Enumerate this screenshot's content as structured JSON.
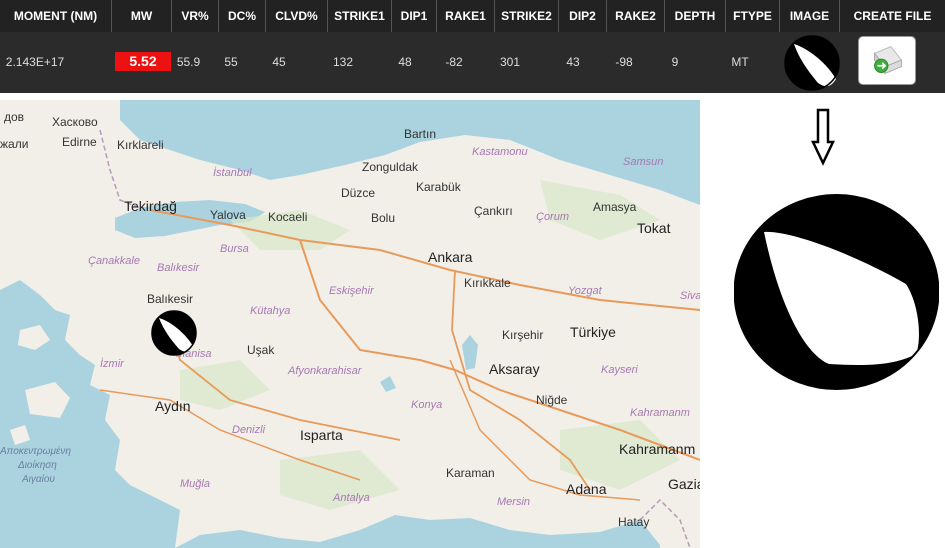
{
  "table": {
    "headers": [
      "MOMENT (NM)",
      "MW",
      "VR%",
      "DC%",
      "CLVD%",
      "STRIKE1",
      "DIP1",
      "RAKE1",
      "STRIKE2",
      "DIP2",
      "RAKE2",
      "DEPTH",
      "FTYPE",
      "IMAGE",
      "CREATE FILE"
    ],
    "row": {
      "moment": "2.143E+17",
      "mw": "5.52",
      "vr": "55.9",
      "dc": "55",
      "clvd": "45",
      "strike1": "132",
      "dip1": "48",
      "rake1": "-82",
      "strike2": "301",
      "dip2": "43",
      "rake2": "-98",
      "depth": "9",
      "ftype": "MT"
    }
  },
  "colors": {
    "mw_badge": "#ee1111",
    "header_bg": "#222222",
    "row_bg": "#2b2b2b",
    "sea": "#aad3df",
    "land": "#f2efe9"
  },
  "icons": {
    "image_cell": "beachball-icon",
    "create_file": "create-file-icon",
    "arrow": "down-arrow-icon"
  },
  "map": {
    "labels": {
      "edirne": "Edirne",
      "kirklareli": "Kırklareli",
      "hackovo": "Хасково",
      "dov": "дов",
      "zhali": "жали",
      "tekirdag": "Tekirdağ",
      "istanbul": "İstanbul",
      "yalova": "Yalova",
      "kocaeli": "Kocaeli",
      "duzce": "Düzce",
      "zonguldak": "Zonguldak",
      "bartin": "Bartın",
      "karabuk": "Karabük",
      "kastamonu": "Kastamonu",
      "samsun": "Samsun",
      "amasya": "Amasya",
      "tokat": "Tokat",
      "bolu": "Bolu",
      "cankiri": "Çankırı",
      "corum": "Çorum",
      "ankara": "Ankara",
      "kirikkale": "Kırıkkale",
      "yozgat": "Yozgat",
      "sivas": "Siva",
      "canakkale": "Çanakkale",
      "balikesir_prov": "Balıkesir",
      "bursa": "Bursa",
      "balikesir": "Balıkesir",
      "eskisehir": "Eskişehir",
      "kutahya": "Kütahya",
      "manisa": "Manisa",
      "usak": "Uşak",
      "izmir": "İzmir",
      "afyon": "Afyonkarahisar",
      "kirsehir": "Kırşehir",
      "turkiye": "Türkiye",
      "aksaray": "Aksaray",
      "kayseri": "Kayseri",
      "aydin": "Aydın",
      "nigde": "Niğde",
      "kahramanmaras_prov": "Kahramanm",
      "denizli": "Denizli",
      "isparta": "Isparta",
      "konya": "Konya",
      "kahramanmaras": "Kahramanm",
      "aegean1": "Αποκεντρωμένη",
      "aegean2": "Διοίκηση",
      "aegean3": "Αιγαίου",
      "mugla": "Muğla",
      "karaman": "Karaman",
      "adana": "Adana",
      "gazi": "Gazia",
      "antalya": "Antalya",
      "mersin": "Mersin",
      "hatay": "Hatay"
    }
  }
}
